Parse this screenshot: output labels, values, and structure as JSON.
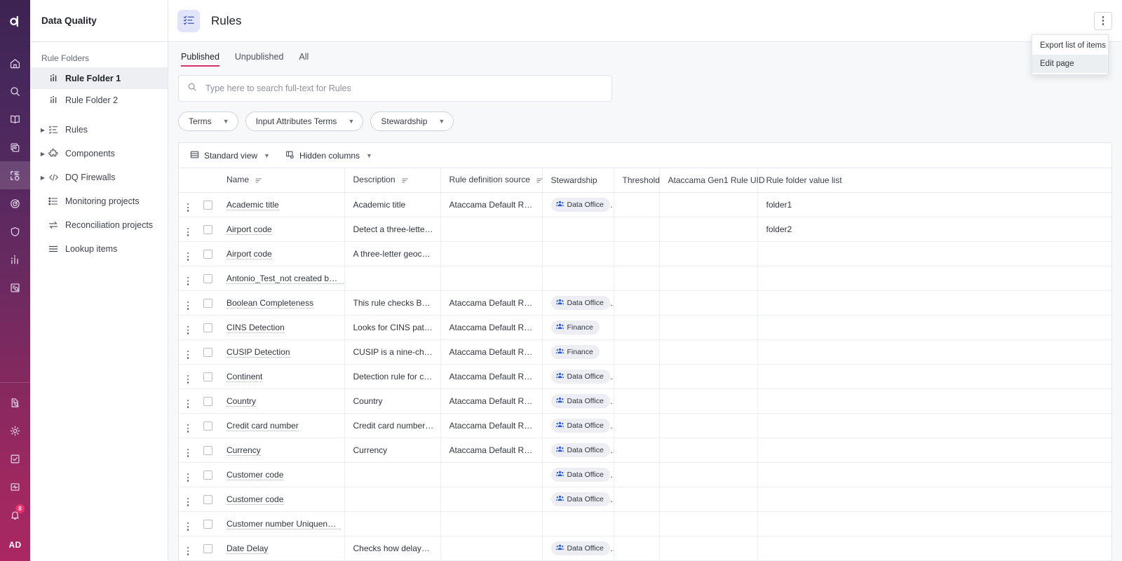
{
  "rail": {
    "logo": "ataccama-logo-icon",
    "items": [
      {
        "name": "home-icon",
        "active": false
      },
      {
        "name": "search-icon",
        "active": false
      },
      {
        "name": "book-icon",
        "active": false
      },
      {
        "name": "catalog-icon",
        "active": false
      },
      {
        "name": "data-quality-icon",
        "active": true
      },
      {
        "name": "target-icon",
        "active": false
      },
      {
        "name": "shield-icon",
        "active": false
      },
      {
        "name": "bar-chart-icon",
        "active": false
      },
      {
        "name": "document-search-icon",
        "active": false
      }
    ],
    "bottom_items": [
      {
        "name": "file-search-icon"
      },
      {
        "name": "gear-icon"
      },
      {
        "name": "task-check-icon"
      },
      {
        "name": "monitor-pulse-icon"
      }
    ],
    "notifications_count": "8",
    "avatar_initials": "AD"
  },
  "sidebar": {
    "title": "Data Quality",
    "section_label": "Rule Folders",
    "folders": [
      {
        "label": "Rule Folder 1",
        "active": true
      },
      {
        "label": "Rule Folder 2",
        "active": false
      }
    ],
    "tree": [
      {
        "label": "Rules",
        "icon": "checklist-icon",
        "expandable": true
      },
      {
        "label": "Components",
        "icon": "puzzle-icon",
        "expandable": true
      },
      {
        "label": "DQ Firewalls",
        "icon": "code-icon",
        "expandable": true
      },
      {
        "label": "Monitoring projects",
        "icon": "list-icon",
        "expandable": false
      },
      {
        "label": "Reconciliation projects",
        "icon": "swap-arrows-icon",
        "expandable": false
      },
      {
        "label": "Lookup items",
        "icon": "lines-icon",
        "expandable": false
      }
    ]
  },
  "header": {
    "title": "Rules",
    "icon": "rules-checklist-icon"
  },
  "menu": {
    "items": [
      {
        "label": "Export list of items",
        "hover": false
      },
      {
        "label": "Edit page",
        "hover": true
      }
    ]
  },
  "filters": {
    "tabs": [
      {
        "label": "Published",
        "active": true
      },
      {
        "label": "Unpublished",
        "active": false
      },
      {
        "label": "All",
        "active": false
      }
    ],
    "search": {
      "value": "",
      "placeholder": "Type here to search full-text for Rules"
    },
    "chips": [
      {
        "label": "Terms"
      },
      {
        "label": "Input Attributes Terms"
      },
      {
        "label": "Stewardship"
      }
    ]
  },
  "table_toolbar": {
    "view_label": "Standard view",
    "hidden_columns_label": "Hidden columns"
  },
  "table": {
    "columns": [
      {
        "label": "Name",
        "sortable": true
      },
      {
        "label": "Description",
        "sortable": true
      },
      {
        "label": "Rule definition source",
        "sortable": true
      },
      {
        "label": "Stewardship",
        "sortable": false
      },
      {
        "label": "Threshold",
        "sortable": false
      },
      {
        "label": "Ataccama Gen1 Rule UID",
        "sortable": false
      },
      {
        "label": "Rule folder value list",
        "sortable": false
      }
    ],
    "rows": [
      {
        "name": "Academic title",
        "description": "Academic title",
        "source": "Ataccama Default Rules",
        "stewardship": "Data Office",
        "threshold": "",
        "gen1_uid": "",
        "folder_value": "folder1"
      },
      {
        "name": "Airport code",
        "description": "Detect a three-letter g…",
        "source": "",
        "stewardship": "",
        "threshold": "",
        "gen1_uid": "",
        "folder_value": "folder2"
      },
      {
        "name": "Airport code",
        "description": "A three-letter geocode…",
        "source": "",
        "stewardship": "",
        "threshold": "",
        "gen1_uid": "",
        "folder_value": ""
      },
      {
        "name": "Antonio_Test_not created by user",
        "description": "",
        "source": "",
        "stewardship": "",
        "threshold": "",
        "gen1_uid": "",
        "folder_value": ""
      },
      {
        "name": "Boolean Completeness",
        "description": "This rule checks Boole…",
        "source": "Ataccama Default Rules",
        "stewardship": "Data Office",
        "threshold": "",
        "gen1_uid": "",
        "folder_value": ""
      },
      {
        "name": "CINS Detection",
        "description": "Looks for CINS pattern.",
        "source": "Ataccama Default Rules",
        "stewardship": "Finance",
        "threshold": "",
        "gen1_uid": "",
        "folder_value": ""
      },
      {
        "name": "CUSIP Detection",
        "description": " CUSIP is a nine-chara…",
        "source": "Ataccama Default Rules",
        "stewardship": "Finance",
        "threshold": "",
        "gen1_uid": "",
        "folder_value": ""
      },
      {
        "name": "Continent",
        "description": "Detection rule for cont…",
        "source": "Ataccama Default Rules",
        "stewardship": "Data Office",
        "threshold": "",
        "gen1_uid": "",
        "folder_value": ""
      },
      {
        "name": "Country",
        "description": "Country",
        "source": "Ataccama Default Rules",
        "stewardship": "Data Office",
        "threshold": "",
        "gen1_uid": "",
        "folder_value": ""
      },
      {
        "name": "Credit card number",
        "description": "Credit card number is …",
        "source": "Ataccama Default Rules",
        "stewardship": "Data Office",
        "threshold": "",
        "gen1_uid": "",
        "folder_value": ""
      },
      {
        "name": "Currency",
        "description": "Currency",
        "source": "Ataccama Default Rules",
        "stewardship": "Data Office",
        "threshold": "",
        "gen1_uid": "",
        "folder_value": ""
      },
      {
        "name": "Customer code",
        "description": "",
        "source": "",
        "stewardship": "Data Office",
        "threshold": "",
        "gen1_uid": "",
        "folder_value": ""
      },
      {
        "name": "Customer code",
        "description": "",
        "source": "",
        "stewardship": "Data Office",
        "threshold": "",
        "gen1_uid": "",
        "folder_value": ""
      },
      {
        "name": "Customer number Uniqueness",
        "description": "",
        "source": "",
        "stewardship": "",
        "threshold": "",
        "gen1_uid": "",
        "folder_value": ""
      },
      {
        "name": "Date Delay",
        "description": "Checks how delayed t…",
        "source": "",
        "stewardship": "Data Office",
        "threshold": "",
        "gen1_uid": "",
        "folder_value": ""
      }
    ]
  },
  "colors": {
    "accent_pink": "#d6336c",
    "badge_blue": "#2a5bd7",
    "header_icon_bg": "#e2e4fb",
    "rail_top": "#3c2352",
    "rail_bottom": "#aa2762"
  }
}
